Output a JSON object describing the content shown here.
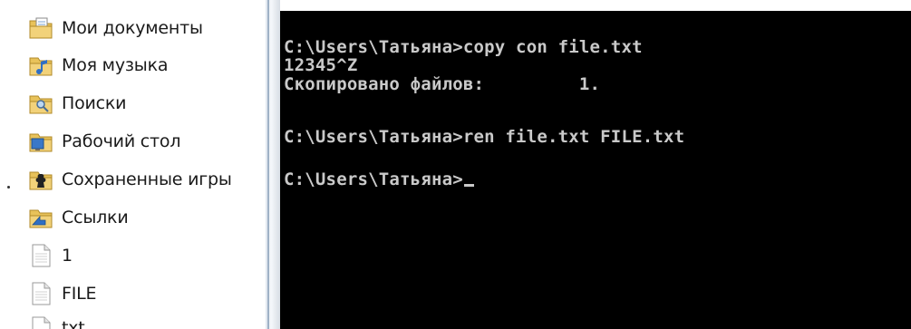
{
  "explorer": {
    "items": [
      {
        "label": "Мои документы",
        "icon": "documents-folder-icon"
      },
      {
        "label": "Моя музыка",
        "icon": "music-folder-icon"
      },
      {
        "label": "Поиски",
        "icon": "searches-folder-icon"
      },
      {
        "label": "Рабочий стол",
        "icon": "desktop-folder-icon"
      },
      {
        "label": "Сохраненные игры",
        "icon": "saved-games-folder-icon"
      },
      {
        "label": "Ссылки",
        "icon": "links-folder-icon"
      },
      {
        "label": "1",
        "icon": "file-icon"
      },
      {
        "label": "FILE",
        "icon": "file-icon"
      },
      {
        "label": "txt",
        "icon": "file-icon"
      }
    ]
  },
  "console": {
    "lines": [
      "C:\\Users\\Татьяна>copy con file.txt",
      "12345^Z",
      "Скопировано файлов:         1.",
      "",
      "C:\\Users\\Татьяна>ren file.txt FILE.txt",
      "",
      "C:\\Users\\Татьяна>"
    ],
    "text_color": "#c9c9c9",
    "background": "#000000"
  }
}
